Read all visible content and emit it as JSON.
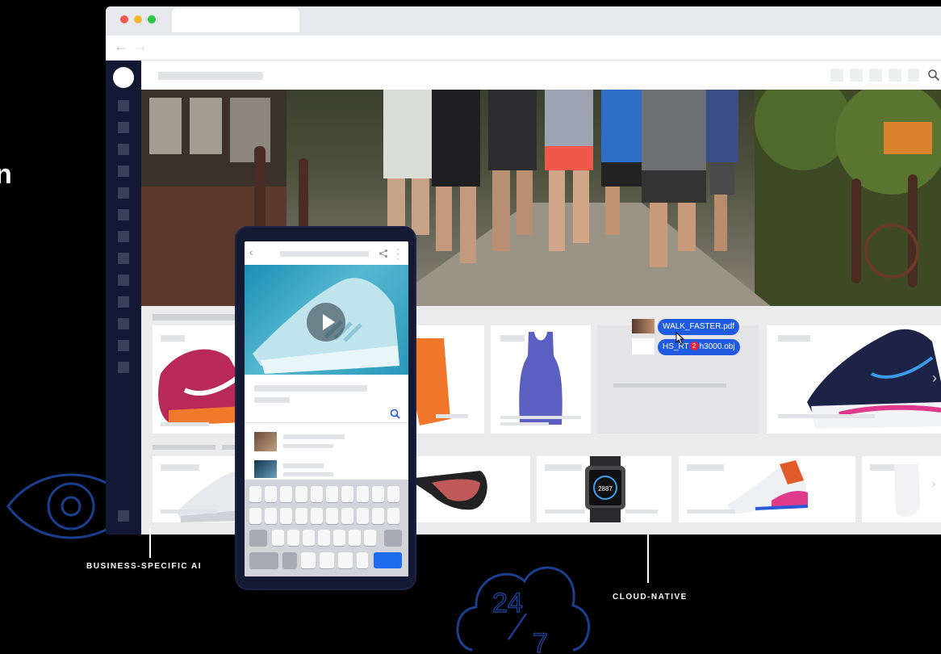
{
  "attachments": {
    "file1": "WALK_FASTER.pdf",
    "file2_prefix": "HS_RT",
    "file2_suffix": "h3000.obj",
    "file2_badge": "2"
  },
  "watch": {
    "display": "2887"
  },
  "labels": {
    "business_ai": "BUSINESS-SPECIFIC AI",
    "cloud_native": "CLOUD-NATIVE",
    "twenty_four": "24",
    "seven": "7",
    "edge_char": "n"
  },
  "icons": {
    "back": "back-arrow-icon",
    "forward": "forward-arrow-icon",
    "search": "search-icon",
    "share": "share-icon",
    "more": "more-vertical-icon",
    "play": "play-icon",
    "eye": "eye-icon",
    "cloud": "cloud-icon"
  },
  "colors": {
    "background": "#000000",
    "sidebar": "#121733",
    "accent_blue": "#1f5ae0",
    "line_art": "#1c3e8f",
    "badge_red": "#e0243a"
  }
}
